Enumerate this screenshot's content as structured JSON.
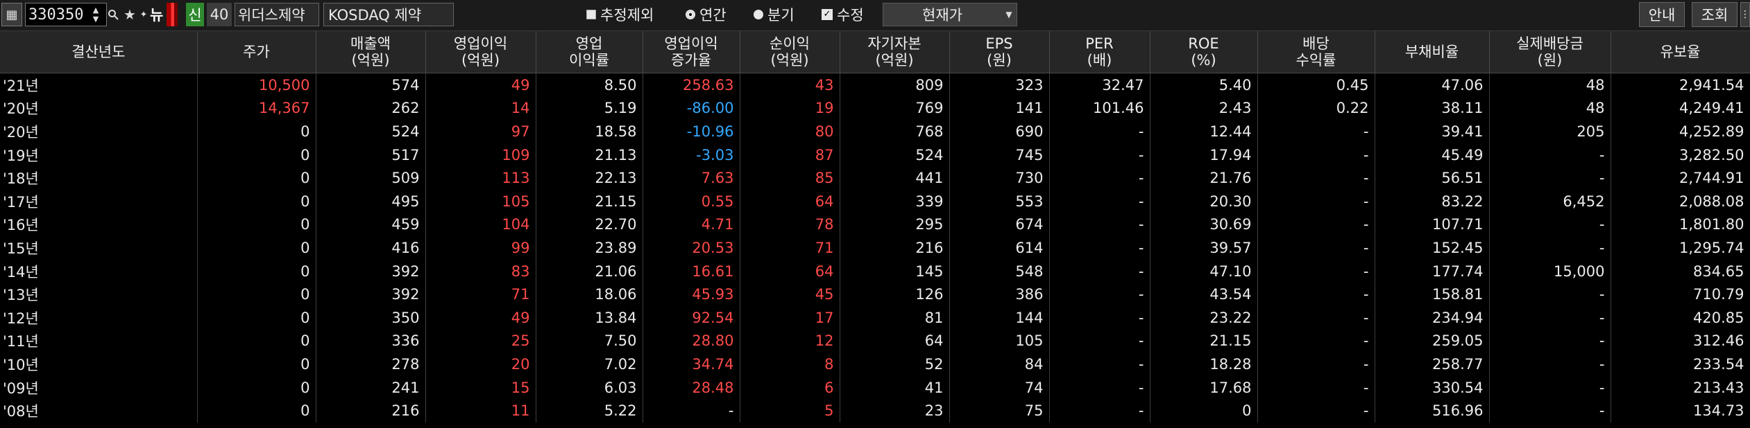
{
  "toolbar": {
    "stock_code": "330350",
    "new_label": "뉴",
    "shin_label": "신",
    "shin_num": "40",
    "company": "위더스제약",
    "market": "KOSDAQ 제약",
    "options": [
      {
        "label": "추정제외",
        "type": "checkbox",
        "checked": false
      },
      {
        "label": "연간",
        "type": "radio",
        "checked": true
      },
      {
        "label": "분기",
        "type": "radio",
        "checked": false
      },
      {
        "label": "수정",
        "type": "checkbox",
        "checked": true
      }
    ],
    "price_select": "현재가",
    "buttons": {
      "guide": "안내",
      "search": "조회"
    }
  },
  "icons": [
    "table-icon",
    "spin-up-down-icon",
    "search-icon",
    "star-icon",
    "plus-icon",
    "chevron-down-icon"
  ],
  "table": {
    "headers": [
      [
        "결산년도"
      ],
      [
        "주가"
      ],
      [
        "매출액",
        "(억원)"
      ],
      [
        "영업이익",
        "(억원)"
      ],
      [
        "영업",
        "이익률"
      ],
      [
        "영업이익",
        "증가율"
      ],
      [
        "순이익",
        "(억원)"
      ],
      [
        "자기자본",
        "(억원)"
      ],
      [
        "EPS",
        "(원)"
      ],
      [
        "PER",
        "(배)"
      ],
      [
        "ROE",
        "(%)"
      ],
      [
        "배당",
        "수익률"
      ],
      [
        "부채비율"
      ],
      [
        "실제배당금",
        "(원)"
      ],
      [
        "유보율"
      ]
    ],
    "rows": [
      [
        "'21년",
        "10,500",
        "574",
        "49",
        "8.50",
        "258.63",
        "43",
        "809",
        "323",
        "32.47",
        "5.40",
        "0.45",
        "47.06",
        "48",
        "2,941.54"
      ],
      [
        "'20년",
        "14,367",
        "262",
        "14",
        "5.19",
        "-86.00",
        "19",
        "769",
        "141",
        "101.46",
        "2.43",
        "0.22",
        "38.11",
        "48",
        "4,249.41"
      ],
      [
        "'20년",
        "0",
        "524",
        "97",
        "18.58",
        "-10.96",
        "80",
        "768",
        "690",
        "-",
        "12.44",
        "-",
        "39.41",
        "205",
        "4,252.89"
      ],
      [
        "'19년",
        "0",
        "517",
        "109",
        "21.13",
        "-3.03",
        "87",
        "524",
        "745",
        "-",
        "17.94",
        "-",
        "45.49",
        "-",
        "3,282.50"
      ],
      [
        "'18년",
        "0",
        "509",
        "113",
        "22.13",
        "7.63",
        "85",
        "441",
        "730",
        "-",
        "21.76",
        "-",
        "56.51",
        "-",
        "2,744.91"
      ],
      [
        "'17년",
        "0",
        "495",
        "105",
        "21.15",
        "0.55",
        "64",
        "339",
        "553",
        "-",
        "20.30",
        "-",
        "83.22",
        "6,452",
        "2,088.08"
      ],
      [
        "'16년",
        "0",
        "459",
        "104",
        "22.70",
        "4.71",
        "78",
        "295",
        "674",
        "-",
        "30.69",
        "-",
        "107.71",
        "-",
        "1,801.80"
      ],
      [
        "'15년",
        "0",
        "416",
        "99",
        "23.89",
        "20.53",
        "71",
        "216",
        "614",
        "-",
        "39.57",
        "-",
        "152.45",
        "-",
        "1,295.74"
      ],
      [
        "'14년",
        "0",
        "392",
        "83",
        "21.06",
        "16.61",
        "64",
        "145",
        "548",
        "-",
        "47.10",
        "-",
        "177.74",
        "15,000",
        "834.65"
      ],
      [
        "'13년",
        "0",
        "392",
        "71",
        "18.06",
        "45.93",
        "45",
        "126",
        "386",
        "-",
        "43.54",
        "-",
        "158.81",
        "-",
        "710.79"
      ],
      [
        "'12년",
        "0",
        "350",
        "49",
        "13.84",
        "92.54",
        "17",
        "81",
        "144",
        "-",
        "23.22",
        "-",
        "234.94",
        "-",
        "420.85"
      ],
      [
        "'11년",
        "0",
        "336",
        "25",
        "7.50",
        "28.80",
        "12",
        "64",
        "105",
        "-",
        "21.15",
        "-",
        "259.05",
        "-",
        "312.46"
      ],
      [
        "'10년",
        "0",
        "278",
        "20",
        "7.02",
        "34.74",
        "8",
        "52",
        "84",
        "-",
        "18.28",
        "-",
        "258.77",
        "-",
        "233.54"
      ],
      [
        "'09년",
        "0",
        "241",
        "15",
        "6.03",
        "28.48",
        "6",
        "41",
        "74",
        "-",
        "17.68",
        "-",
        "330.54",
        "-",
        "213.43"
      ],
      [
        "'08년",
        "0",
        "216",
        "11",
        "5.22",
        "-",
        "5",
        "23",
        "75",
        "-",
        "0",
        "-",
        "516.96",
        "-",
        "134.73"
      ]
    ]
  },
  "colors": {
    "positive": "#ff4a4a",
    "negative": "#33a8ff",
    "header_bg": "#262626",
    "body_bg": "#000000"
  }
}
